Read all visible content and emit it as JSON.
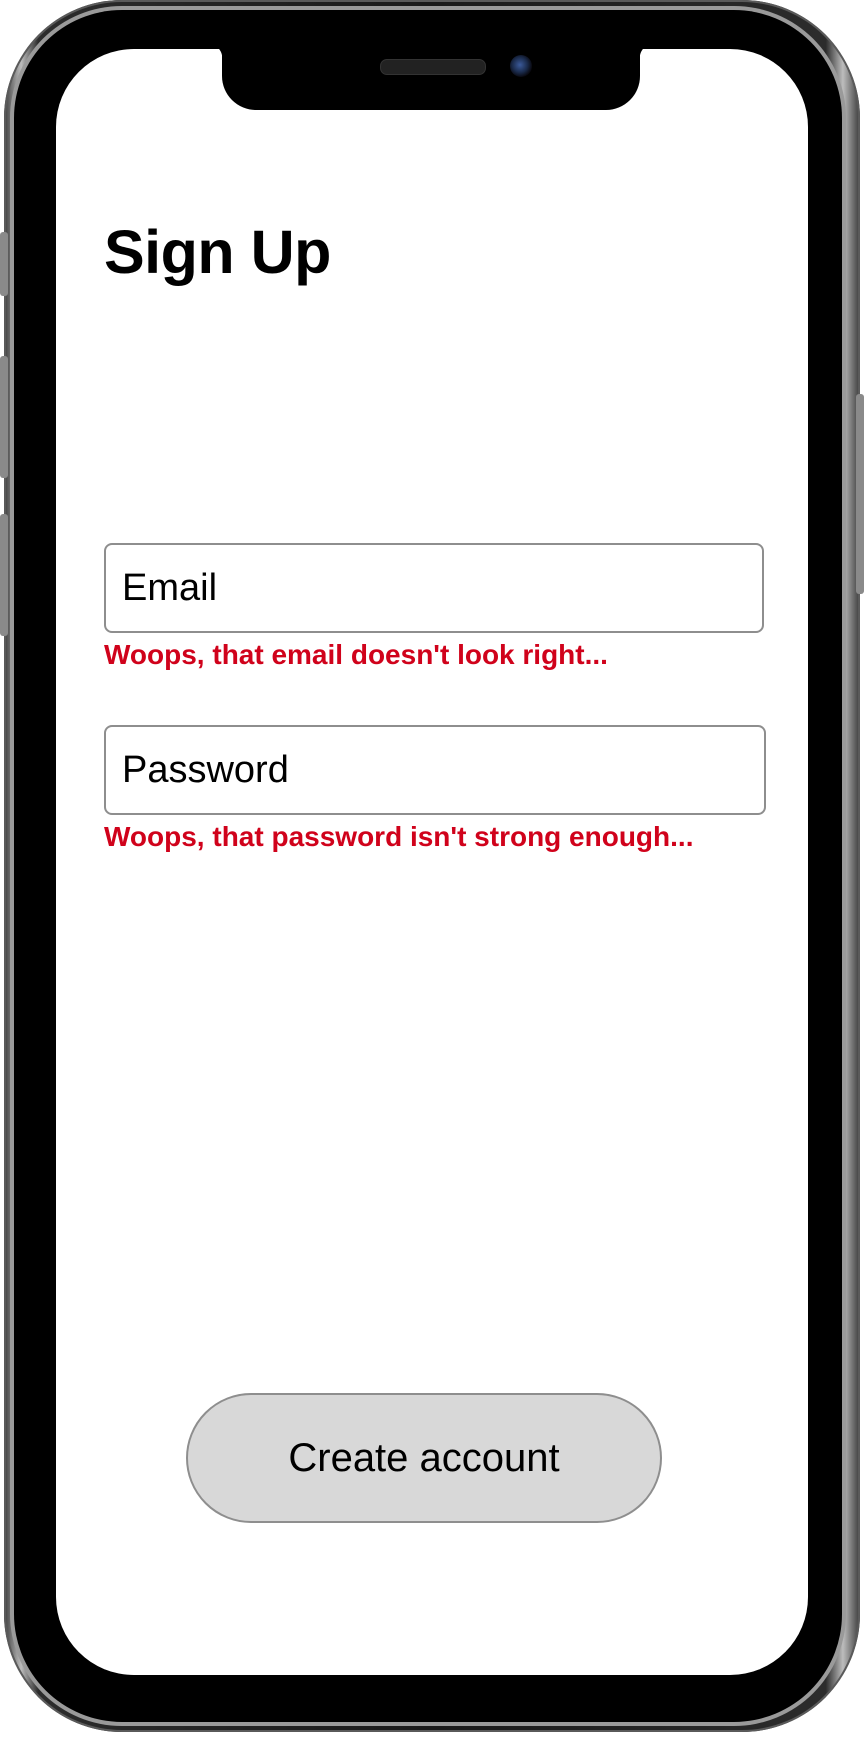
{
  "signup": {
    "title": "Sign Up",
    "email": {
      "placeholder": "Email",
      "value": "",
      "error": "Woops, that email doesn't look right..."
    },
    "password": {
      "placeholder": "Password",
      "value": "",
      "error": "Woops, that password isn't strong enough..."
    },
    "create_account_label": "Create account"
  },
  "colors": {
    "error_text": "#d0021b",
    "button_bg": "#d8d8d8",
    "field_border": "#8e8e8e",
    "screen_bg": "#ffffff"
  },
  "icons": {
    "camera": "front-camera-icon",
    "speaker": "earpiece-speaker-icon"
  }
}
